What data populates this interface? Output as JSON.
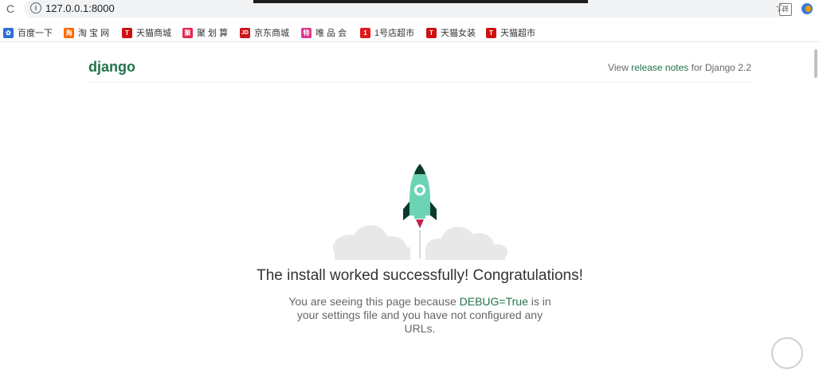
{
  "browser": {
    "url": "127.0.0.1:8000",
    "reload_glyph": "C",
    "info_glyph": "i",
    "translate_glyph": "译",
    "star_glyph": "☆"
  },
  "bookmarks": [
    {
      "label": "百度一下",
      "icon": "baidu-icon",
      "color": "#2e6fd8",
      "glyph": "✿"
    },
    {
      "label": "淘 宝 网",
      "icon": "taobao-icon",
      "color": "#ff6a00",
      "glyph": "淘"
    },
    {
      "label": "天猫商城",
      "icon": "tmall-icon",
      "color": "#d01010",
      "glyph": "T"
    },
    {
      "label": "聚 划 算",
      "icon": "juhuasuan-icon",
      "color": "#e02a50",
      "glyph": "聚"
    },
    {
      "label": "京东商城",
      "icon": "jd-icon",
      "color": "#c8161d",
      "glyph": "JD"
    },
    {
      "label": "唯 品 会",
      "icon": "vip-icon",
      "color": "#e0338f",
      "glyph": "特"
    },
    {
      "label": "1号店超市",
      "icon": "yhd-icon",
      "color": "#e31a1a",
      "glyph": "1"
    },
    {
      "label": "天猫女装",
      "icon": "tmall-women-icon",
      "color": "#d01010",
      "glyph": "T"
    },
    {
      "label": "天猫超市",
      "icon": "tmall-market-icon",
      "color": "#d01010",
      "glyph": "T"
    }
  ],
  "page": {
    "logo": "django",
    "release_prefix": "View ",
    "release_link": "release notes",
    "release_suffix": " for Django 2.2",
    "title": "The install worked successfully! Congratulations!",
    "desc_prefix": "You are seeing this page because ",
    "desc_debug": "DEBUG=True",
    "desc_suffix": " is in your settings file and you have not configured any URLs."
  },
  "colors": {
    "accent": "#20734b",
    "rocket": "#6dd3b5",
    "rocket_dark": "#0c3b2e",
    "flame": "#c1234a",
    "cloud": "#e5e5e5"
  }
}
